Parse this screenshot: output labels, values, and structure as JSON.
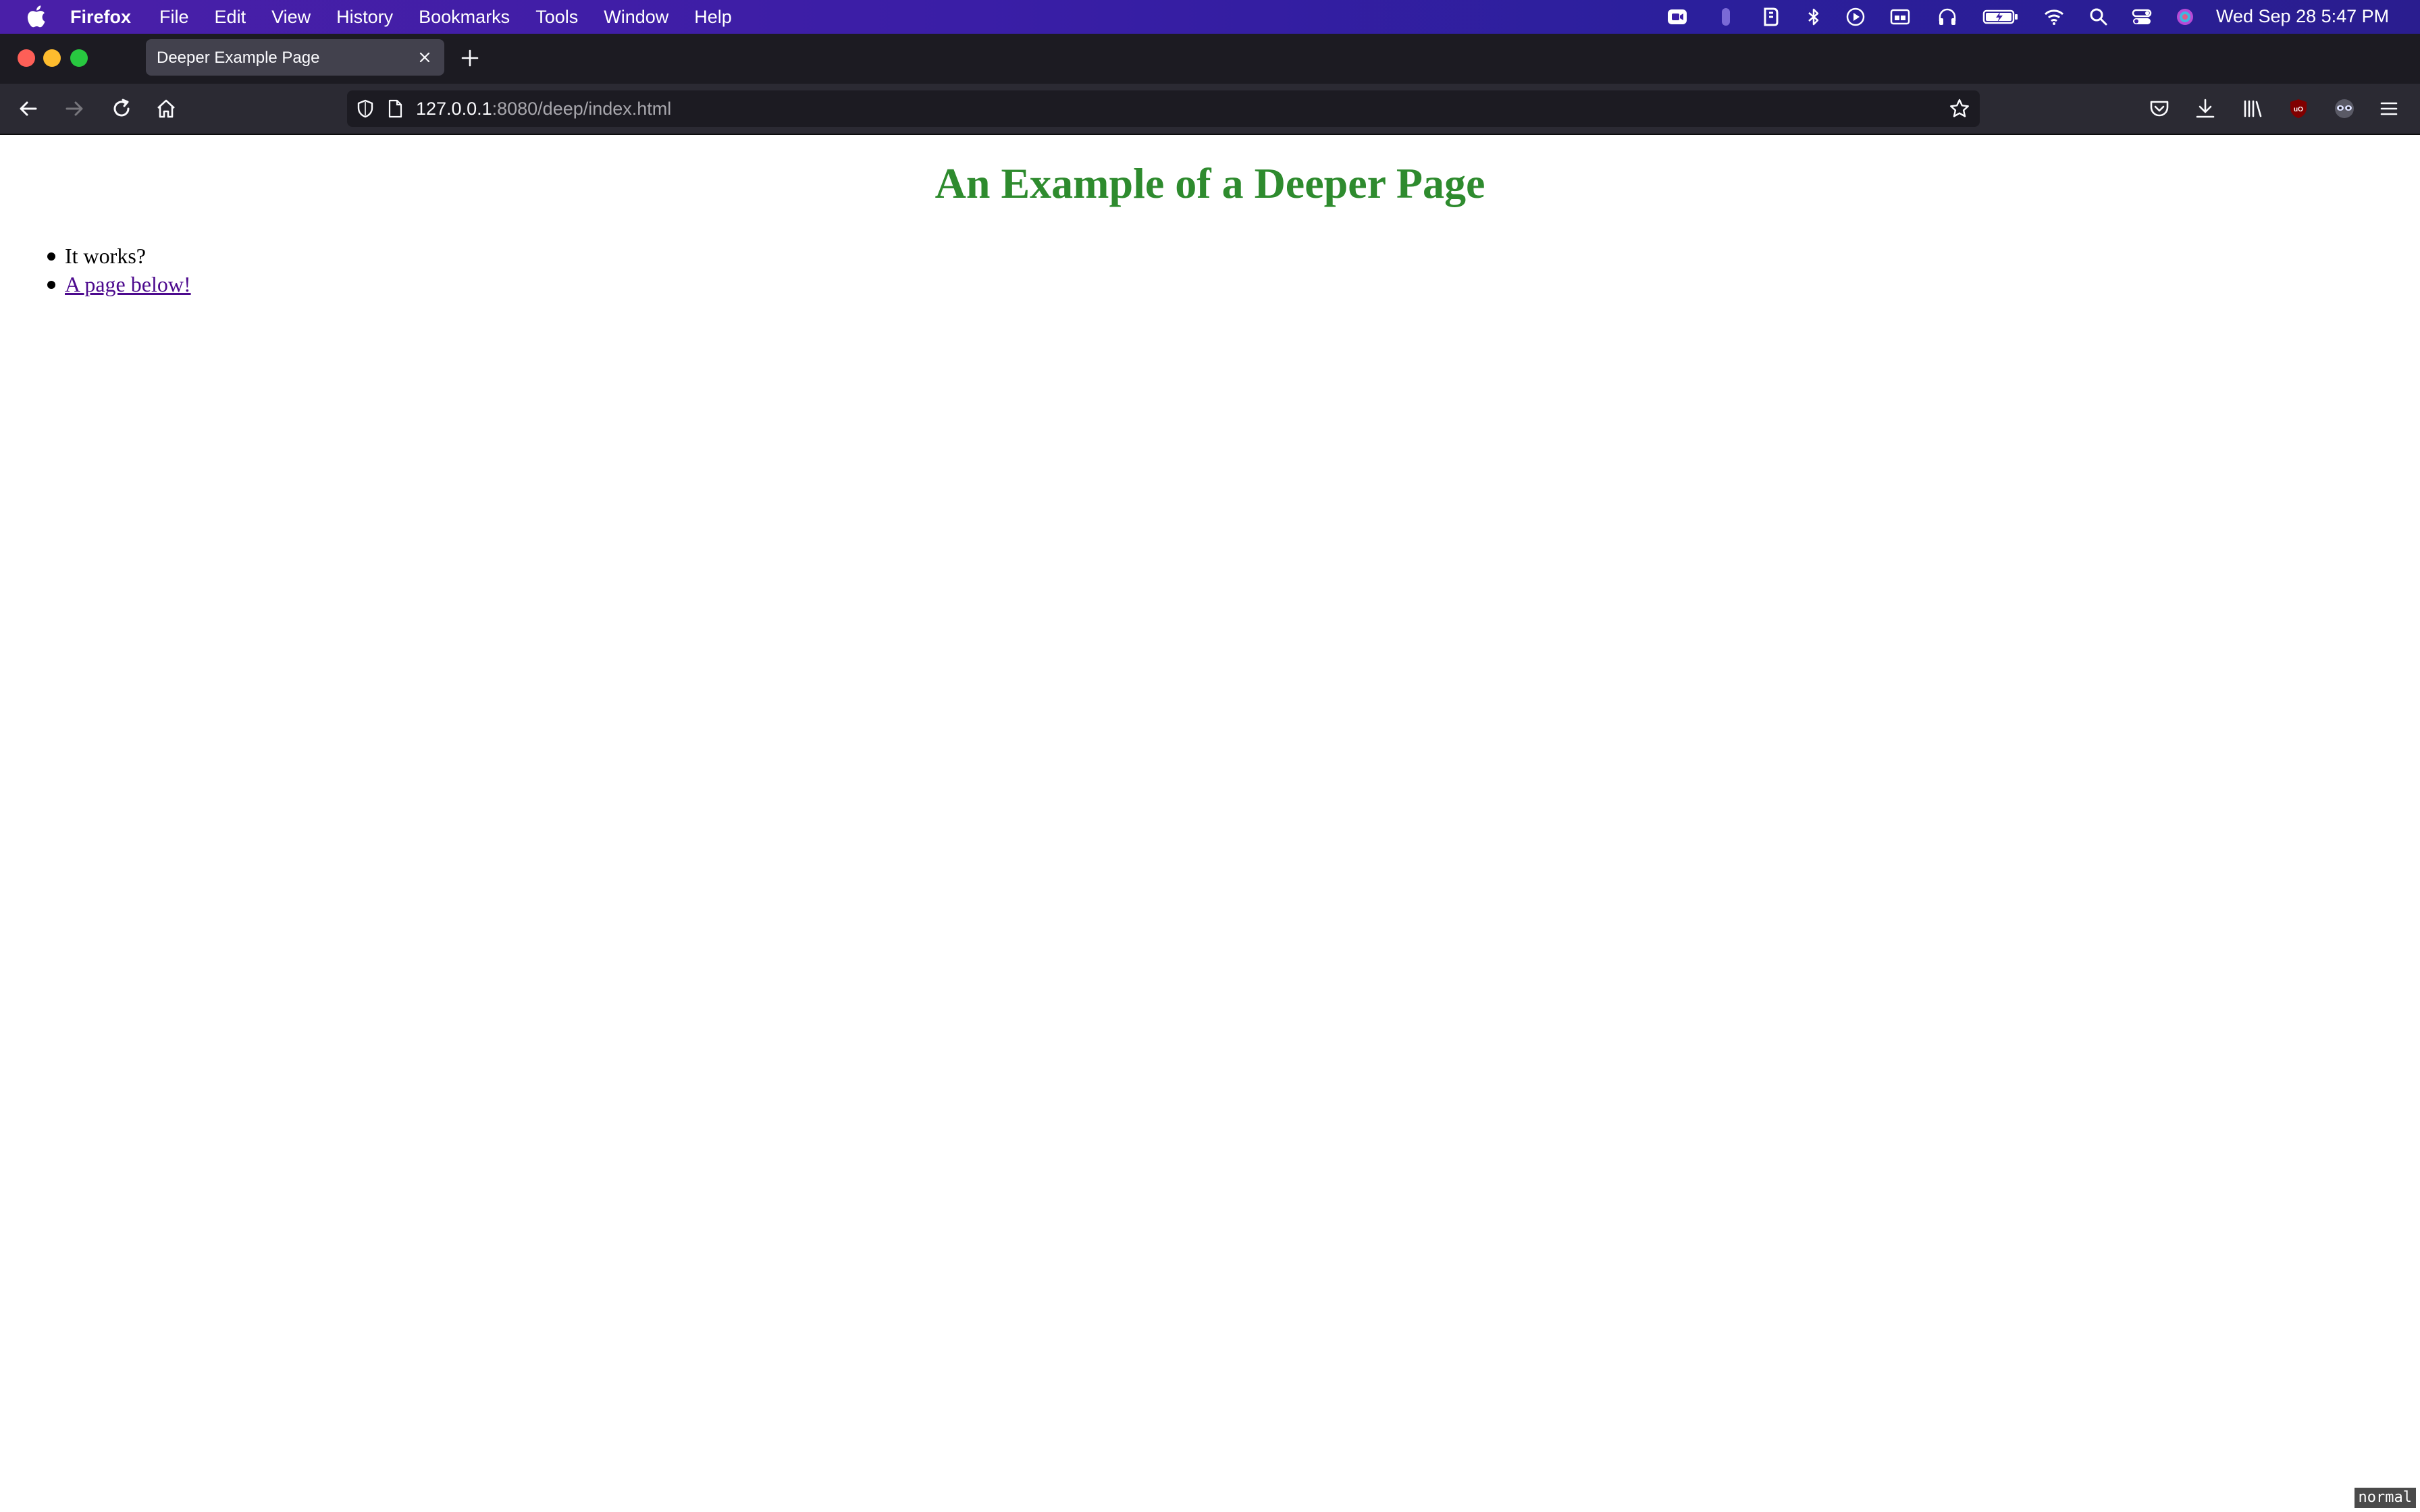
{
  "menubar": {
    "app_name": "Firefox",
    "menus": [
      "File",
      "Edit",
      "View",
      "History",
      "Bookmarks",
      "Tools",
      "Window",
      "Help"
    ],
    "clock": "Wed Sep 28  5:47 PM",
    "status_icons": [
      "zoom-icon",
      "mouse-icon",
      "bartender-icon",
      "bluetooth-icon",
      "play-icon",
      "display-icon",
      "headphones-icon",
      "battery-icon",
      "wifi-icon",
      "spotlight-icon",
      "control-center-icon",
      "siri-icon"
    ]
  },
  "browser": {
    "tab_title": "Deeper Example Page",
    "url_host": "127.0.0.1",
    "url_rest": ":8080/deep/index.html"
  },
  "page": {
    "heading": "An Example of a Deeper Page",
    "heading_color": "#2e8b2e",
    "items": [
      {
        "text": "It works?",
        "link": false
      },
      {
        "text": "A page below!",
        "link": true
      }
    ]
  },
  "mode_indicator": "normal"
}
